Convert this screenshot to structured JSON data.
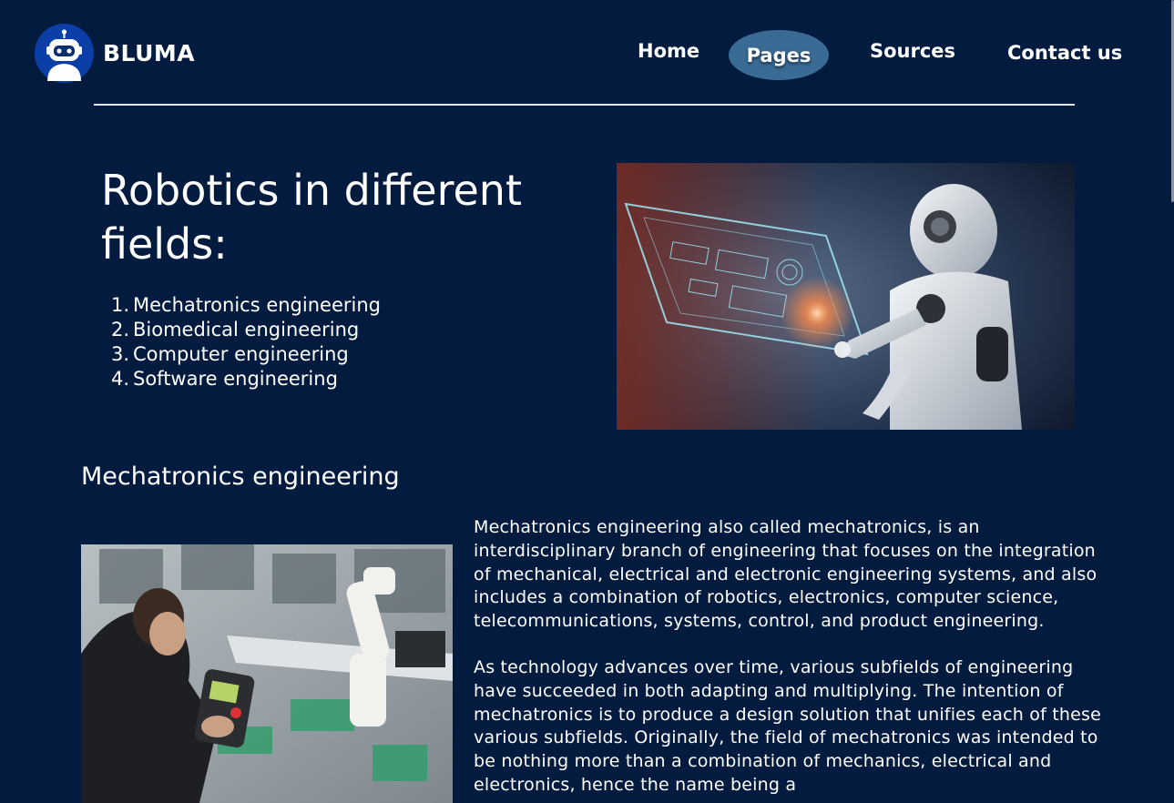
{
  "brand": {
    "name": "BLUMA",
    "logo_icon": "robot-icon"
  },
  "nav": {
    "items": [
      {
        "label": "Home",
        "active": false
      },
      {
        "label": "Pages",
        "active": true
      },
      {
        "label": "Sources",
        "active": false
      },
      {
        "label": "Contact us",
        "active": false
      }
    ]
  },
  "hero": {
    "title": "Robotics in different fields:",
    "fields": [
      {
        "num": "1.",
        "label": "Mechatronics engineering"
      },
      {
        "num": "2.",
        "label": "Biomedical engineering"
      },
      {
        "num": "3.",
        "label": "Computer engineering"
      },
      {
        "num": "4.",
        "label": "Software engineering"
      }
    ],
    "image": "robot-touching-holographic-screen"
  },
  "section": {
    "title": "Mechatronics engineering",
    "image": "engineer-with-robotic-arm-controller",
    "paragraphs": [
      "Mechatronics engineering also called mechatronics, is an interdisciplinary branch of engineering that focuses on the integration of mechanical, electrical and electronic engineering systems, and also includes a combination of robotics, electronics, computer science, telecommunications, systems, control, and product engineering.",
      "As technology advances over time, various subfields of engineering have succeeded in both adapting and multiplying. The intention of mechatronics is to produce a design solution that unifies each of these various subfields. Originally, the field of mechatronics was intended to be nothing more than a combination of mechanics, electrical and electronics, hence the name being a"
    ]
  },
  "colors": {
    "background": "#021b3f",
    "logo_circle": "#0b3ea6",
    "active_nav": "#3a6b94",
    "text": "#ffffff"
  }
}
